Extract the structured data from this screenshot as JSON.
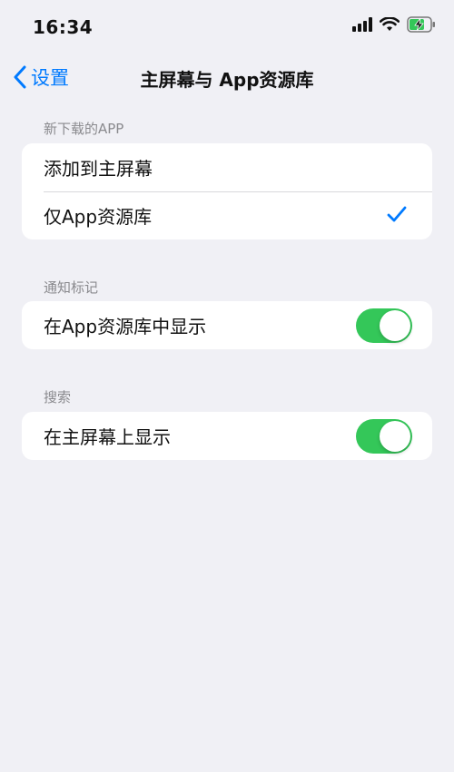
{
  "status_bar": {
    "time": "16:34",
    "icons": [
      "cellular-signal-icon",
      "wifi-icon",
      "battery-charging-icon"
    ]
  },
  "nav": {
    "back_label": "设置",
    "title": "主屏幕与 App资源库"
  },
  "sections": [
    {
      "header": "新下载的APP",
      "rows": [
        {
          "label": "添加到主屏幕",
          "selected": false
        },
        {
          "label": "仅App资源库",
          "selected": true
        }
      ]
    },
    {
      "header": "通知标记",
      "rows": [
        {
          "label": "在App资源库中显示",
          "toggle": true
        }
      ]
    },
    {
      "header": "搜索",
      "rows": [
        {
          "label": "在主屏幕上显示",
          "toggle": true
        }
      ]
    }
  ],
  "colors": {
    "accent": "#007aff",
    "toggle_on": "#34c759",
    "background": "#f0f0f5"
  }
}
